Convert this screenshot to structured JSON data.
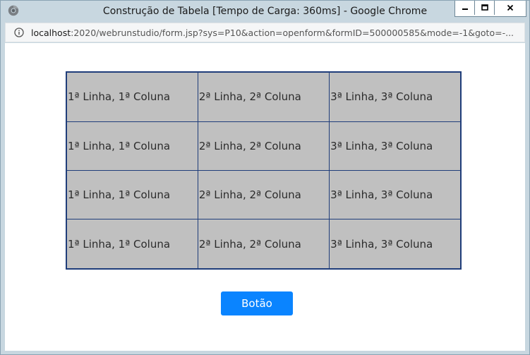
{
  "window": {
    "title": "Construção de Tabela [Tempo de Carga: 360ms] - Google Chrome",
    "controls": {
      "minimize": "–",
      "maximize": "□",
      "close": "x"
    }
  },
  "addressbar": {
    "host": "localhost",
    "path": ":2020/webrunstudio/form.jsp?sys=P10&action=openform&formID=500000585&mode=-1&goto=-..."
  },
  "table": {
    "rows": [
      [
        "1ª Linha, 1ª Coluna",
        "2ª Linha, 2ª Coluna",
        "3ª Linha, 3ª Coluna"
      ],
      [
        "1ª Linha, 1ª Coluna",
        "2ª Linha, 2ª Coluna",
        "3ª Linha, 3ª Coluna"
      ],
      [
        "1ª Linha, 1ª Coluna",
        "2ª Linha, 2ª Coluna",
        "3ª Linha, 3ª Coluna"
      ],
      [
        "1ª Linha, 1ª Coluna",
        "2ª Linha, 2ª Coluna",
        "3ª Linha, 3ª Coluna"
      ]
    ],
    "cell_color": "#c0c0c0",
    "border_color": "#1f3d7a"
  },
  "button": {
    "label": "Botão",
    "color": "#0a84ff"
  },
  "icons": {
    "app": "chrome-app-icon",
    "info": "info-icon"
  }
}
